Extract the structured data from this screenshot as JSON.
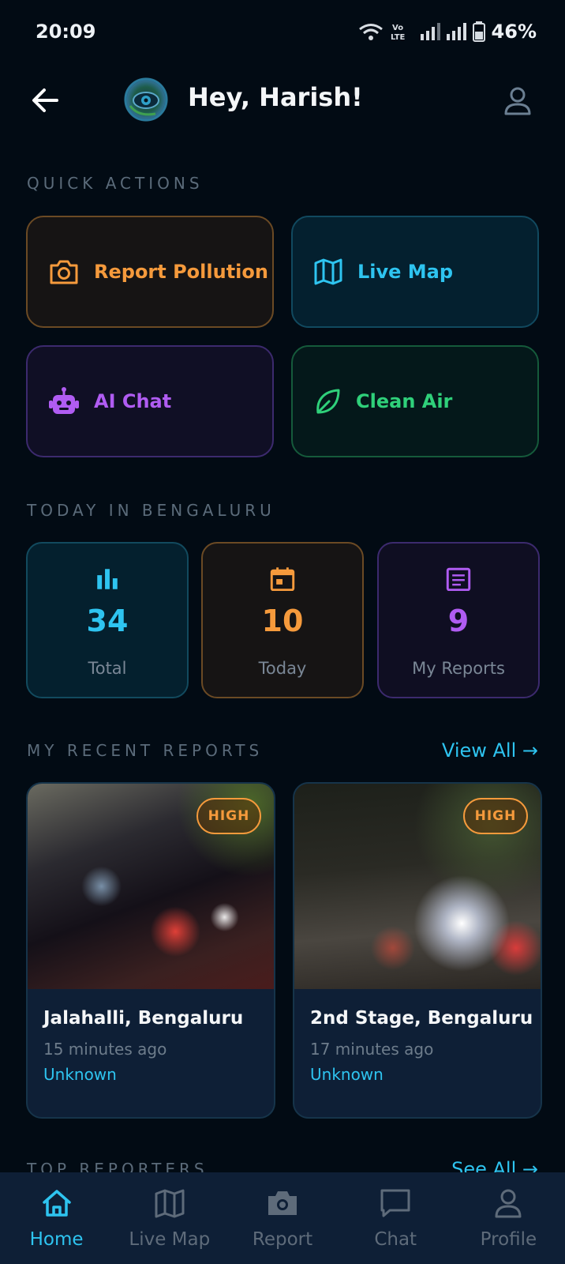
{
  "status_bar": {
    "time": "20:09",
    "battery": "46%"
  },
  "header": {
    "greeting": "Hey, Harish!"
  },
  "quick_actions": {
    "label": "QUICK ACTIONS",
    "items": [
      {
        "label": "Report Pollution",
        "icon": "camera-icon",
        "color": "#f59a3c"
      },
      {
        "label": "Live Map",
        "icon": "map-icon",
        "color": "#2ec4f0"
      },
      {
        "label": "AI Chat",
        "icon": "robot-icon",
        "color": "#b05cf2"
      },
      {
        "label": "Clean Air",
        "icon": "leaf-icon",
        "color": "#2fd07a"
      }
    ]
  },
  "today": {
    "label": "TODAY IN BENGALURU",
    "stats": [
      {
        "value": "34",
        "caption": "Total",
        "icon": "bar-chart-icon",
        "color": "#2ec4f0"
      },
      {
        "value": "10",
        "caption": "Today",
        "icon": "calendar-icon",
        "color": "#f59a3c"
      },
      {
        "value": "9",
        "caption": "My Reports",
        "icon": "document-icon",
        "color": "#b05cf2"
      }
    ]
  },
  "recent": {
    "label": "MY RECENT REPORTS",
    "view_all": "View All →",
    "reports": [
      {
        "severity": "HIGH",
        "location": "Jalahalli, Bengaluru",
        "time": "15 minutes ago",
        "status": "Unknown"
      },
      {
        "severity": "HIGH",
        "location": "2nd Stage, Bengaluru",
        "time": "17 minutes ago",
        "status": "Unknown"
      }
    ]
  },
  "top_reporters": {
    "label": "TOP REPORTERS",
    "see_all": "See All →"
  },
  "bottom_nav": {
    "items": [
      {
        "label": "Home",
        "icon": "home-icon",
        "active": true
      },
      {
        "label": "Live Map",
        "icon": "map-icon",
        "active": false
      },
      {
        "label": "Report",
        "icon": "camera-icon",
        "active": false
      },
      {
        "label": "Chat",
        "icon": "chat-icon",
        "active": false
      },
      {
        "label": "Profile",
        "icon": "user-icon",
        "active": false
      }
    ]
  },
  "colors": {
    "background": "#020b14",
    "accent_cyan": "#2ec4f0",
    "accent_orange": "#f59a3c",
    "accent_purple": "#b05cf2",
    "accent_green": "#2fd07a",
    "nav_background": "#0e1f36"
  }
}
